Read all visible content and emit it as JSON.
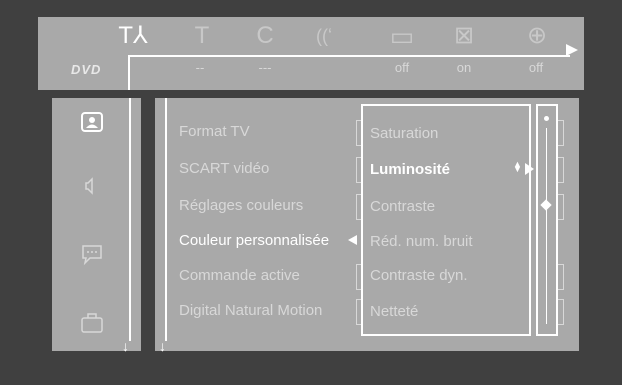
{
  "toolbar": {
    "logo": "DVD",
    "tabs": [
      {
        "icon": "settings-tools-icon",
        "glyph": "T⅄",
        "value": ""
      },
      {
        "icon": "title-icon",
        "glyph": "T",
        "value": "--"
      },
      {
        "icon": "chapter-icon",
        "glyph": "C",
        "value": "---"
      },
      {
        "icon": "audio-language-icon",
        "glyph": "((ʻ",
        "value": ""
      },
      {
        "icon": "subtitle-icon",
        "glyph": "▭",
        "value": "off"
      },
      {
        "icon": "camera-angle-icon",
        "glyph": "⊠",
        "value": "on"
      },
      {
        "icon": "zoom-icon",
        "glyph": "⊕",
        "value": "off"
      }
    ]
  },
  "sidebar": {
    "icons": [
      "picture-icon",
      "sound-icon",
      "language-icon",
      "features-icon"
    ]
  },
  "menu": {
    "items": [
      "Format TV",
      "SCART vidéo",
      "Réglages couleurs",
      "Couleur personnalisée",
      "Commande active",
      "Digital Natural Motion"
    ],
    "active_index": 3
  },
  "submenu": {
    "items": [
      "Saturation",
      "Luminosité",
      "Contraste",
      "Réd. num. bruit",
      "Contraste dyn.",
      "Netteté"
    ],
    "active_index": 1
  },
  "colors": {
    "background": "#404040",
    "panel": "#a9a9a9",
    "highlight": "#ffffff",
    "text": "#d8d8d8"
  }
}
